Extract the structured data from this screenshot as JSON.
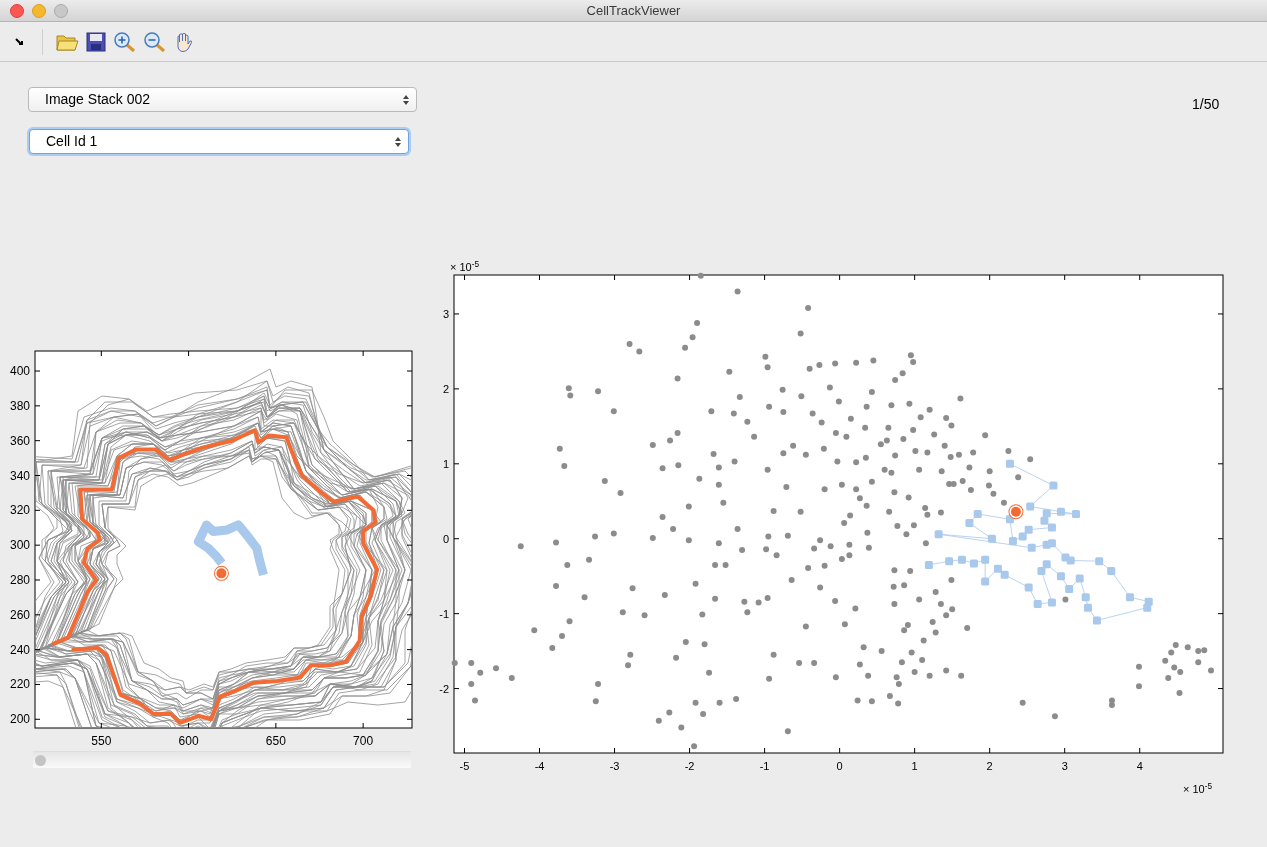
{
  "window": {
    "title": "CellTrackViewer"
  },
  "controls": [
    {
      "kind": "select",
      "value": "Image Stack 002",
      "focused": false
    },
    {
      "kind": "select",
      "value": "Cell Id 1",
      "focused": true
    }
  ],
  "frame_counter": "1/50",
  "frame_slider": {
    "level": 0
  },
  "cell_plot": {
    "chart_data": {
      "type": "line",
      "xlim": [
        512,
        728
      ],
      "ylim": [
        195,
        411.5
      ],
      "xticks": [
        550,
        600,
        650,
        700
      ],
      "yticks": [
        200,
        220,
        240,
        260,
        280,
        300,
        320,
        340,
        360,
        380,
        400
      ],
      "series": [
        {
          "color": "#f26b35",
          "marker": "none",
          "x": [
            522,
            531,
            542,
            547,
            540,
            542,
            549,
            548,
            539,
            538,
            556,
            560,
            570,
            581,
            589,
            597,
            608,
            625,
            638,
            640,
            646,
            656,
            661,
            665,
            675,
            683,
            697,
            706,
            707,
            700,
            700,
            708,
            704,
            699,
            698,
            690,
            681,
            670,
            664,
            651,
            637,
            626,
            618,
            613,
            606,
            595,
            590,
            580,
            572,
            561,
            553,
            548,
            533
          ],
          "values": [
            243,
            247,
            273,
            280,
            290,
            298,
            303,
            307,
            315,
            332,
            332,
            350,
            355,
            355,
            349,
            352,
            356,
            360,
            366,
            359,
            363,
            362,
            349,
            340,
            331,
            325,
            328,
            320,
            313,
            308,
            301,
            286,
            270,
            259,
            245,
            233,
            231,
            231,
            224,
            222,
            221,
            216,
            213,
            200,
            202,
            198,
            203,
            203,
            209,
            214,
            237,
            241,
            240
          ]
        },
        {
          "color": "#a8c8ec",
          "marker": "none",
          "x": [
            619,
            616.1,
            611.3,
            605.6,
            610.3,
            614.2,
            621.8,
            628.5,
            633.3,
            639.1,
            640.6,
            642.9
          ],
          "values": [
            289.6,
            293.4,
            298.2,
            302,
            311.6,
            307.8,
            308.7,
            311.6,
            305.8,
            298.2,
            291.5,
            282.9
          ]
        },
        {
          "color": "#f26b35",
          "marker": "circle",
          "x": [
            618.8
          ],
          "values": [
            283.8
          ]
        }
      ]
    }
  },
  "feature_plot": {
    "x_exponent": "× 10$^{-5}$",
    "y_exponent": "× 10$^{-5}$",
    "chart_data": {
      "type": "scatter",
      "xlim": [
        -5.14,
        5.11
      ],
      "ylim": [
        -2.86,
        3.52
      ],
      "xticks": [
        -5,
        -4,
        -3,
        -2,
        -1,
        0,
        1,
        2,
        3,
        4
      ],
      "yticks": [
        -2,
        -1,
        0,
        1,
        2,
        3
      ],
      "series": [
        {
          "color": "#8c8c8c",
          "marker": "circle",
          "x": [
            -5.13,
            -4.91,
            -4.91,
            -4.86,
            -4.79,
            -4.58,
            -4.37,
            -4.25,
            -4.07,
            -3.83,
            -3.78,
            -3.73,
            -3.67,
            -3.61,
            -3.59,
            -3.78,
            -3.63,
            -3.7,
            -3.6,
            -3.34,
            -3.4,
            -3.22,
            -3.13,
            -3.26,
            -3.22,
            -3.25,
            -3.01,
            -2.92,
            -3.01,
            -2.89,
            -2.8,
            -2.67,
            -2.76,
            -2.82,
            -2.79,
            -2.6,
            -2.49,
            -2.49,
            -2.36,
            -2.36,
            -2.33,
            -2.41,
            -2.27,
            -2.26,
            -2.16,
            -2.16,
            -2.15,
            -2.22,
            -2.18,
            -2.11,
            -2.06,
            -1.96,
            -1.9,
            -2.01,
            -2.01,
            -2.05,
            -1.92,
            -1.87,
            -1.83,
            -1.92,
            -1.85,
            -1.94,
            -1.82,
            -1.8,
            -1.71,
            -1.68,
            -1.61,
            -1.61,
            -1.66,
            -1.66,
            -1.61,
            -1.55,
            -1.74,
            -1.6,
            -1.52,
            -1.47,
            -1.4,
            -1.41,
            -1.36,
            -1.33,
            -1.36,
            -1.38,
            -1.3,
            -1.27,
            -1.23,
            -1.23,
            -1.14,
            -1.08,
            -0.99,
            -0.96,
            -0.94,
            -0.96,
            -0.95,
            -0.98,
            -0.96,
            -0.88,
            -0.88,
            -0.84,
            -0.94,
            -0.76,
            -0.75,
            -0.75,
            -0.71,
            -0.69,
            -0.69,
            -0.64,
            -0.62,
            -0.54,
            -0.52,
            -0.51,
            -0.52,
            -0.45,
            -0.45,
            -0.42,
            -0.4,
            -0.42,
            -0.36,
            -0.34,
            -0.34,
            -0.27,
            -0.26,
            -0.26,
            -0.24,
            -0.21,
            -0.2,
            -0.2,
            -0.13,
            -0.12,
            -0.06,
            -0.06,
            -0.05,
            -0.03,
            -0.05,
            -0.01,
            0.03,
            0.03,
            0.06,
            0.07,
            0.09,
            0.13,
            0.13,
            0.14,
            0.15,
            0.22,
            0.22,
            0.22,
            0.21,
            0.24,
            0.27,
            0.32,
            0.27,
            0.34,
            0.36,
            0.35,
            0.36,
            0.37,
            0.39,
            0.38,
            0.43,
            0.45,
            0.43,
            0.43,
            0.55,
            0.56,
            0.6,
            0.63,
            0.66,
            0.65,
            0.67,
            0.69,
            0.69,
            0.73,
            0.72,
            0.73,
            0.74,
            0.73,
            0.76,
            0.77,
            0.78,
            0.79,
            0.74,
            0.83,
            0.84,
            0.85,
            0.86,
            0.86,
            0.89,
            0.92,
            0.93,
            0.94,
            0.91,
            0.95,
            0.96,
            0.98,
            0.98,
            0.99,
            1.0,
            1.01,
            1.06,
            1.06,
            1.08,
            1.1,
            1.12,
            1.14,
            1.15,
            1.17,
            1.17,
            1.2,
            1.2,
            1.24,
            1.26,
            1.28,
            1.28,
            1.35,
            1.35,
            1.36,
            1.4,
            1.42,
            1.42,
            1.42,
            1.46,
            1.48,
            1.49,
            1.5,
            1.52,
            1.49,
            1.59,
            1.61,
            1.62,
            1.64,
            1.7,
            1.73,
            1.75,
            1.78,
            1.94,
            2.0,
            1.99,
            2.05,
            2.19,
            2.25,
            2.54,
            2.38,
            2.44,
            2.87,
            3.01,
            3.63,
            3.63,
            3.99,
            3.99,
            4.34,
            4.38,
            4.42,
            4.48,
            4.46,
            4.54,
            4.53,
            4.64,
            4.78,
            4.78,
            4.86,
            4.95
          ],
          "values": [
            -1.66,
            -1.66,
            -1.94,
            -2.16,
            -1.79,
            -1.73,
            -1.86,
            -0.1,
            -1.22,
            -1.46,
            -0.05,
            1.2,
            0.97,
            2.01,
            1.91,
            -0.63,
            -0.35,
            -1.3,
            -1.1,
            -0.28,
            -0.78,
            1.97,
            0.77,
            0.03,
            -1.94,
            -2.17,
            1.7,
            0.61,
            0.07,
            -0.98,
            2.6,
            2.5,
            -0.66,
            -1.69,
            -1.55,
            -1.02,
            1.25,
            0.01,
            0.29,
            0.94,
            -0.75,
            -2.43,
            -2.32,
            1.31,
            2.14,
            1.41,
            0.98,
            0.13,
            -1.59,
            -2.52,
            2.55,
            2.69,
            2.88,
            0.43,
            -0.02,
            -1.38,
            -0.6,
            0.8,
            -1.01,
            -2.19,
            3.51,
            -2.77,
            -2.34,
            -1.41,
            1.7,
            1.13,
            0.95,
            0.72,
            -0.35,
            -0.8,
            -0.06,
            0.48,
            -1.79,
            -2.19,
            -0.35,
            2.23,
            1.03,
            1.67,
            3.3,
            1.89,
            0.13,
            -2.14,
            -0.15,
            -0.84,
            1.56,
            -0.98,
            1.36,
            -0.85,
            2.43,
            2.29,
            1.76,
            0.92,
            0.03,
            -0.14,
            -0.79,
            0.37,
            -1.55,
            -0.22,
            -1.87,
            1.99,
            1.69,
            1.14,
            0.69,
            0.04,
            -2.57,
            -0.55,
            1.24,
            -1.66,
            2.74,
            1.9,
            0.36,
            1.12,
            -1.17,
            3.08,
            2.27,
            -0.39,
            1.67,
            -0.13,
            -1.66,
            2.32,
            -0.02,
            -0.65,
            1.55,
            1.2,
            -0.36,
            0.66,
            2.02,
            -0.1,
            2.34,
            -0.83,
            1.41,
            1.03,
            -1.85,
            1.83,
            0.72,
            -0.27,
            0.21,
            -1.14,
            1.36,
            -0.08,
            -0.22,
            0.31,
            1.6,
            1.02,
            2.35,
            0.66,
            -0.93,
            -2.16,
            0.54,
            -1.45,
            -1.68,
            1.48,
            1.76,
            1.08,
            0.44,
            0.08,
            -0.12,
            -1.83,
            1.96,
            2.38,
            0.76,
            -2.17,
            1.26,
            -1.5,
            0.92,
            1.31,
            0.36,
            1.48,
            -2.1,
            1.78,
            0.88,
            -0.42,
            -0.64,
            -0.87,
            2.12,
            0.62,
            -1.85,
            0.17,
            -2.2,
            -1.94,
            1.11,
            -1.65,
            2.21,
            1.33,
            -0.62,
            -1.22,
            0.06,
            0.55,
            1.8,
            -0.43,
            -1.15,
            2.45,
            -1.52,
            2.36,
            1.45,
            0.18,
            -1.78,
            1.17,
            -0.81,
            0.92,
            1.62,
            -1.62,
            -1.36,
            0.41,
            -0.06,
            1.15,
            0.32,
            1.72,
            -1.83,
            -1.11,
            1.39,
            -0.71,
            -1.25,
            -0.87,
            0.35,
            0.9,
            1.24,
            1.61,
            -1.76,
            -1.02,
            0.73,
            1.09,
            1.51,
            -0.94,
            0.73,
            -0.55,
            1.12,
            1.87,
            -1.83,
            0.77,
            -1.19,
            0.95,
            0.65,
            1.15,
            1.38,
            0.9,
            0.71,
            0.6,
            0.48,
            1.17,
            1.06,
            0.82,
            -2.19,
            -2.37,
            -0.81,
            -2.16,
            -2.22,
            -1.71,
            -1.97,
            -1.63,
            -1.86,
            -1.52,
            -1.42,
            -1.72,
            -1.78,
            -2.06,
            -1.45,
            -1.65,
            -1.5,
            -1.49,
            -1.76
          ]
        },
        {
          "color": "#a8c8ec",
          "marker": "square",
          "type": "line",
          "x": [
            2.27,
            2.85,
            2.54,
            2.95,
            3.15,
            2.76,
            2.73,
            2.83,
            2.52,
            2.44,
            2.31,
            2.27,
            1.84,
            1.73,
            2.03,
            1.32,
            2.56,
            2.76,
            2.83,
            3.01,
            3.08,
            3.46,
            3.62,
            3.87,
            4.12,
            4.1,
            3.43,
            3.31,
            3.28,
            3.2,
            3.06,
            2.95,
            2.76,
            2.69,
            2.83,
            2.64,
            2.52,
            2.2,
            2.11,
            1.94,
            1.94,
            1.79,
            1.63,
            1.46,
            1.19
          ],
          "values": [
            1.0,
            0.71,
            0.43,
            0.36,
            0.33,
            0.34,
            0.24,
            0.15,
            0.12,
            0.03,
            -0.03,
            0.26,
            0.33,
            0.21,
            0.0,
            0.06,
            -0.12,
            -0.08,
            -0.06,
            -0.25,
            -0.29,
            -0.3,
            -0.43,
            -0.78,
            -0.84,
            -0.92,
            -1.09,
            -0.92,
            -0.78,
            -0.53,
            -0.67,
            -0.5,
            -0.34,
            -0.43,
            -0.85,
            -0.87,
            -0.65,
            -0.48,
            -0.4,
            -0.57,
            -0.28,
            -0.33,
            -0.28,
            -0.3,
            -0.35
          ]
        },
        {
          "color": "#f26b35",
          "marker": "circle",
          "x": [
            2.35
          ],
          "values": [
            0.36
          ]
        }
      ]
    }
  }
}
